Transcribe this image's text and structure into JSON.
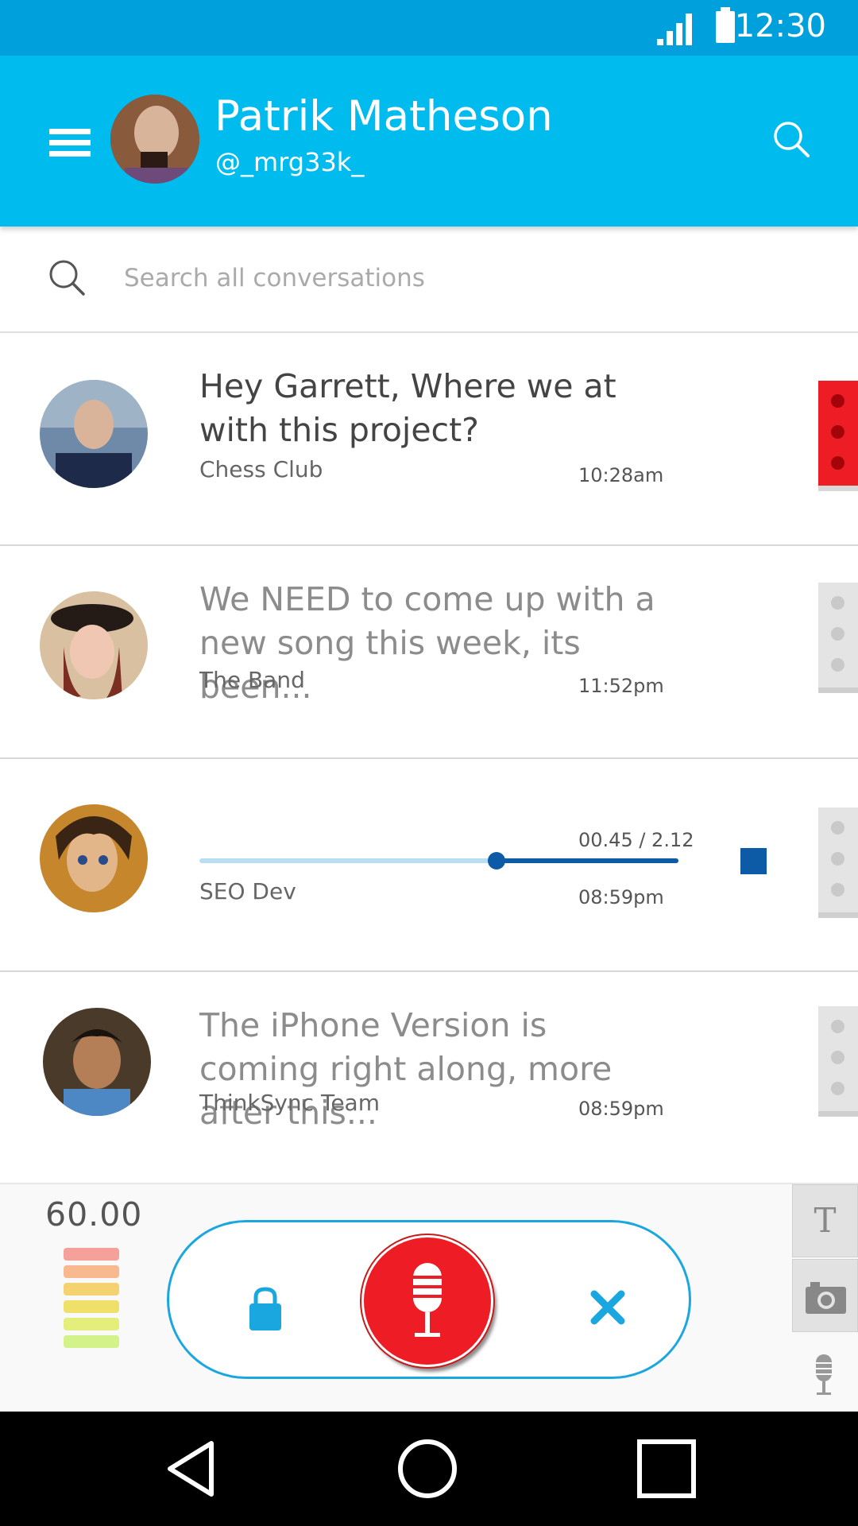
{
  "status_bar": {
    "time": "12:30"
  },
  "header": {
    "name": "Patrik Matheson",
    "handle": "@_mrg33k_"
  },
  "search": {
    "placeholder": "Search all conversations"
  },
  "conversations": [
    {
      "message": "Hey Garrett, Where we at with this project?",
      "group": "Chess Club",
      "time": "10:28am",
      "unread": true
    },
    {
      "message": "We NEED to come up with a new song this week, its been...",
      "group": "The Band",
      "time": "11:52pm",
      "unread": false
    },
    {
      "group": "SEO Dev",
      "time": "08:59pm",
      "audio": {
        "position": "00.45 / 2.12",
        "progress": 0.62
      }
    },
    {
      "message": "The iPhone Version is coming right along, more after this...",
      "group": "ThinkSync Team",
      "time": "08:59pm",
      "unread": false
    }
  ],
  "recorder": {
    "timer": "60.00",
    "level_colors": [
      "#f5a19a",
      "#f7b98d",
      "#f5d270",
      "#efe06a",
      "#e3ef7a",
      "#d4f28a"
    ],
    "accent": "#1aa7e0",
    "record_color": "#ee1c25"
  },
  "tools": {
    "text_label": "T"
  }
}
